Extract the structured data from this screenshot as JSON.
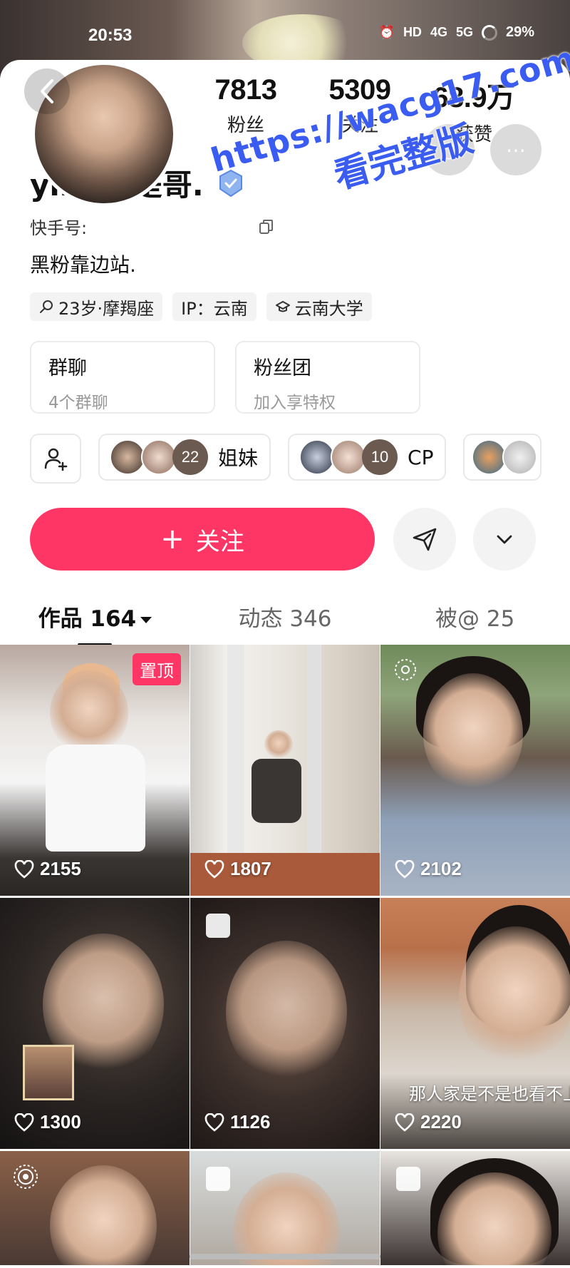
{
  "status_bar": {
    "time": "20:53",
    "hd_label": "HD",
    "network_4g": "4G",
    "network_5g": "5G",
    "battery": "29%"
  },
  "profile": {
    "name": "ying也是哥.",
    "kuaishou_id_label": "快手号:",
    "bio": "黑粉靠边站.",
    "tags": [
      {
        "icon": "search-icon",
        "label": "23岁·摩羯座"
      },
      {
        "icon": "",
        "label": "IP：云南"
      },
      {
        "icon": "school-icon",
        "label": "云南大学"
      }
    ]
  },
  "stats": [
    {
      "value": "7813",
      "label": "粉丝"
    },
    {
      "value": "5309",
      "label": "关注"
    },
    {
      "value": "68.9万",
      "label": "获赞"
    }
  ],
  "boxes": [
    {
      "title": "群聊",
      "subtitle": "4个群聊"
    },
    {
      "title": "粉丝团",
      "subtitle": "加入享特权"
    }
  ],
  "circles": [
    {
      "count": "22",
      "label": "姐妹"
    },
    {
      "count": "10",
      "label": "CP"
    }
  ],
  "actions": {
    "follow_label": "关注",
    "follow_plus": "+"
  },
  "tabs": [
    {
      "label": "作品 164",
      "active": true
    },
    {
      "label": "动态 346",
      "active": false
    },
    {
      "label": "被@ 25",
      "active": false
    }
  ],
  "works": [
    {
      "likes": "2155",
      "pinned_label": "置顶"
    },
    {
      "likes": "1807"
    },
    {
      "likes": "2102"
    },
    {
      "likes": "1300"
    },
    {
      "likes": "1126"
    },
    {
      "likes": "2220",
      "caption": "那人家是不是也看不上你"
    }
  ],
  "watermark": {
    "url": "https://wacg17.com",
    "text": "看完整版"
  },
  "colors": {
    "accent": "#fe3666",
    "watermark": "#3a5cf0"
  }
}
